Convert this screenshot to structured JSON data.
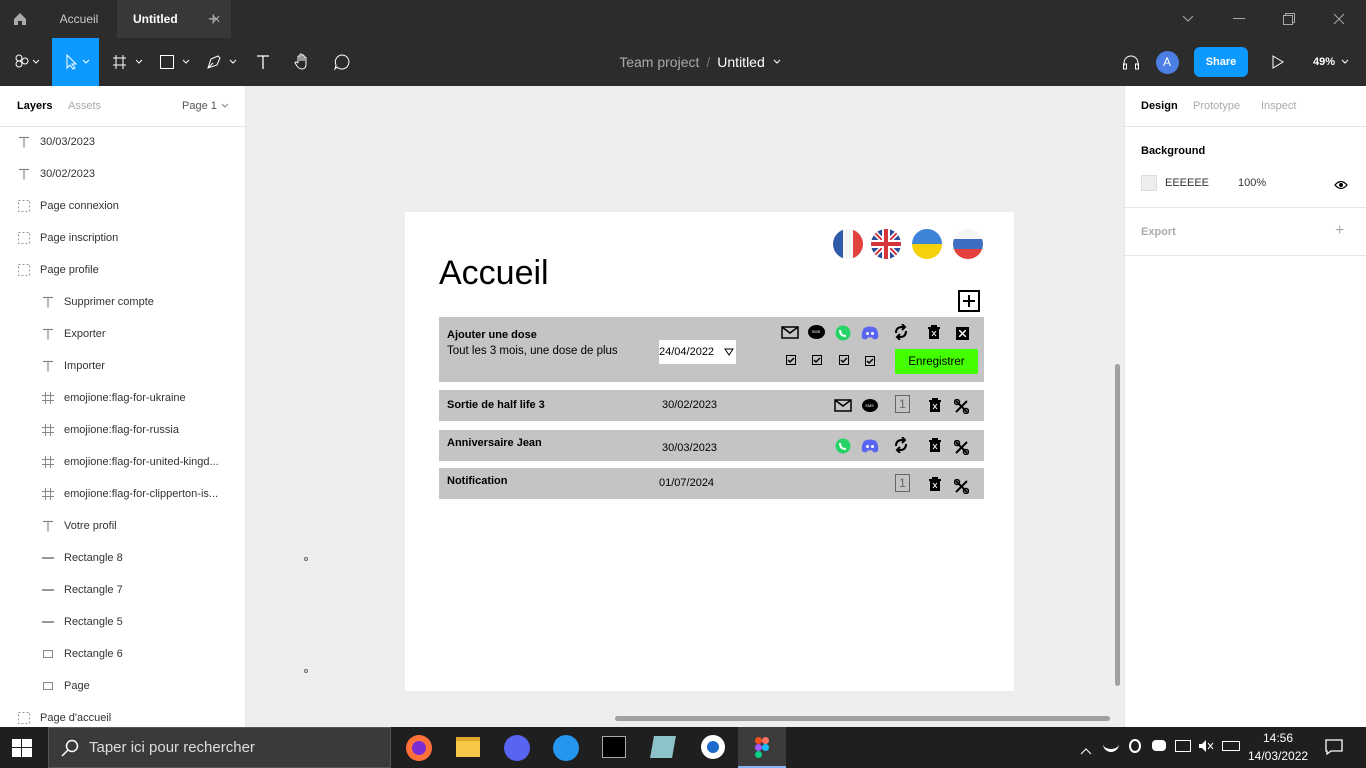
{
  "tabs": {
    "home_icon": "home-icon",
    "accueil": "Accueil",
    "untitled": "Untitled",
    "close": "✕",
    "add": "+"
  },
  "toolbar": {
    "project": "Team project",
    "sep": "/",
    "file": "Untitled",
    "avatar": "A",
    "share": "Share",
    "zoom": "49%"
  },
  "left_panel": {
    "tab_layers": "Layers",
    "tab_assets": "Assets",
    "page": "Page 1",
    "layers": [
      {
        "icon": "text-icon",
        "label": "30/03/2023",
        "indent": 0
      },
      {
        "icon": "text-icon",
        "label": "30/02/2023",
        "indent": 0
      },
      {
        "icon": "frame-dotted-icon",
        "label": "Page connexion",
        "indent": 0
      },
      {
        "icon": "frame-dotted-icon",
        "label": "Page inscription",
        "indent": 0
      },
      {
        "icon": "frame-dotted-icon",
        "label": "Page profile",
        "indent": 0
      },
      {
        "icon": "text-icon",
        "label": "Supprimer compte",
        "indent": 1
      },
      {
        "icon": "text-icon",
        "label": "Exporter",
        "indent": 1
      },
      {
        "icon": "text-icon",
        "label": "Importer",
        "indent": 1
      },
      {
        "icon": "frame-icon",
        "label": "emojione:flag-for-ukraine",
        "indent": 1
      },
      {
        "icon": "frame-icon",
        "label": "emojione:flag-for-russia",
        "indent": 1
      },
      {
        "icon": "frame-icon",
        "label": "emojione:flag-for-united-kingd...",
        "indent": 1
      },
      {
        "icon": "frame-icon",
        "label": "emojione:flag-for-clipperton-is...",
        "indent": 1
      },
      {
        "icon": "text-icon",
        "label": "Votre profil",
        "indent": 1
      },
      {
        "icon": "line-icon",
        "label": "Rectangle 8",
        "indent": 1
      },
      {
        "icon": "line-icon",
        "label": "Rectangle 7",
        "indent": 1
      },
      {
        "icon": "line-icon",
        "label": "Rectangle 5",
        "indent": 1
      },
      {
        "icon": "rect-icon",
        "label": "Rectangle 6",
        "indent": 1
      },
      {
        "icon": "rect-icon",
        "label": "Page",
        "indent": 1
      },
      {
        "icon": "frame-dotted-icon",
        "label": "Page d'accueil",
        "indent": 0
      }
    ]
  },
  "design": {
    "title": "Accueil",
    "rows": [
      {
        "title": "Ajouter une dose",
        "subtitle": "Tout les 3 mois, une dose de plus",
        "date": "24/04/2022",
        "save": "Enregistrer"
      },
      {
        "title": "Sortie de half life 3",
        "date": "30/02/2023"
      },
      {
        "title": "Anniversaire Jean",
        "date": "30/03/2023"
      },
      {
        "title": "Notification",
        "date": "01/07/2024"
      }
    ],
    "sms": "SMS",
    "one": "1"
  },
  "right_panel": {
    "tab_design": "Design",
    "tab_prototype": "Prototype",
    "tab_inspect": "Inspect",
    "background_label": "Background",
    "bg_hex": "EEEEEE",
    "bg_opacity": "100%",
    "export_label": "Export",
    "export_add": "+",
    "help": "?"
  },
  "taskbar": {
    "search_placeholder": "Taper ici pour rechercher",
    "time": "14:56",
    "date": "14/03/2022"
  },
  "colors": {
    "accent": "#0d99ff",
    "save_green": "#44ff00",
    "row_gray": "#c4c4c4",
    "canvas": "#eeeeee"
  }
}
